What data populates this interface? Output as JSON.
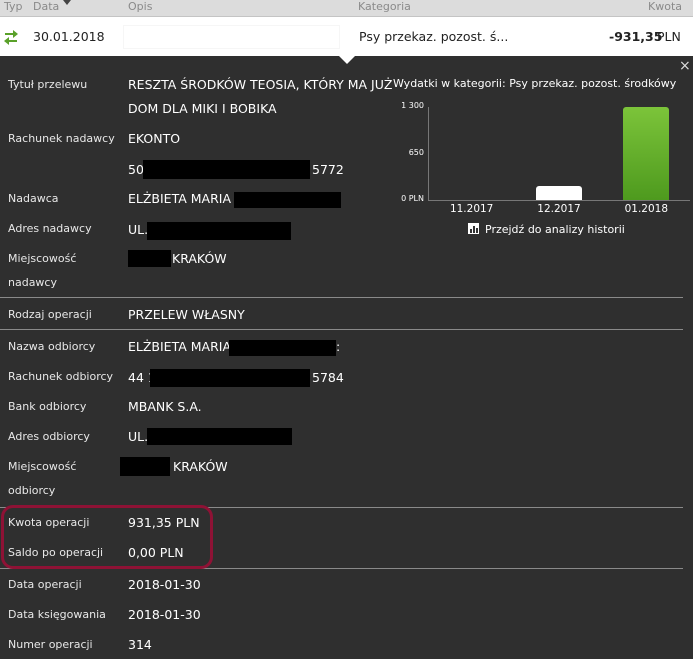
{
  "header": {
    "typ": "Typ",
    "data": "Data",
    "opis": "Opis",
    "kategoria": "Kategoria",
    "kwota": "Kwota"
  },
  "row": {
    "date": "30.01.2018",
    "category": "Psy przekaz. pozost. ś...",
    "amount": "-931,35",
    "currency": "PLN"
  },
  "details": {
    "tytul_label": "Tytuł przelewu",
    "tytul_line1": "RESZTA ŚRODKÓW TEOSIA, KTÓRY MA JUŻ",
    "tytul_line2": "DOM DLA MIKI I BOBIKA",
    "rachunek_nadawcy_label": "Rachunek nadawcy",
    "rachunek_nadawcy_val": "EKONTO",
    "rachunek_nadawcy_num_start": "50",
    "rachunek_nadawcy_num_end": "5772",
    "nadawca_label": "Nadawca",
    "nadawca_val": "ELŻBIETA MARIA M",
    "adres_nadawcy_label": "Adres nadawcy",
    "adres_nadawcy_val": "UL.\\",
    "miejscowosc_nadawcy_label1": "Miejscowość",
    "miejscowosc_nadawcy_label2": "nadawcy",
    "miejscowosc_nadawcy_val": "KRAKÓW",
    "rodzaj_label": "Rodzaj operacji",
    "rodzaj_val": "PRZELEW WŁASNY",
    "nazwa_odbiorcy_label": "Nazwa odbiorcy",
    "nazwa_odbiorcy_val": "ELŻBIETA MARIA",
    "nazwa_odbiorcy_tail": ":",
    "rachunek_odbiorcy_label": "Rachunek odbiorcy",
    "rachunek_odbiorcy_start": "44 1",
    "rachunek_odbiorcy_end": "5784",
    "bank_label": "Bank odbiorcy",
    "bank_val": "MBANK S.A.",
    "adres_odbiorcy_label": "Adres odbiorcy",
    "adres_odbiorcy_val": "UL.\\",
    "miejscowosc_odbiorcy_label1": "Miejscowość",
    "miejscowosc_odbiorcy_label2": "odbiorcy",
    "miejscowosc_odbiorcy_val": "KRAKÓW",
    "kwota_label": "Kwota operacji",
    "kwota_val": "931,35 PLN",
    "saldo_label": "Saldo po operacji",
    "saldo_val": "0,00 PLN",
    "data_op_label": "Data operacji",
    "data_op_val": "2018-01-30",
    "data_ks_label": "Data księgowania",
    "data_ks_val": "2018-01-30",
    "numer_label": "Numer operacji",
    "numer_val": "314"
  },
  "chart_data": {
    "type": "bar",
    "title": "Wydatki w kategorii: Psy przekaz. pozost. środkówy",
    "categories": [
      "11.2017",
      "12.2017",
      "01.2018"
    ],
    "values": [
      0,
      190,
      1300
    ],
    "ylim": [
      0,
      1300
    ],
    "yticks": [
      "0 PLN",
      "650",
      "1 300"
    ],
    "colors": [
      "#ffffff",
      "#ffffff",
      "#6cb12e"
    ]
  },
  "history_link": "Przejdź do analizy historii",
  "close_icon": "×"
}
